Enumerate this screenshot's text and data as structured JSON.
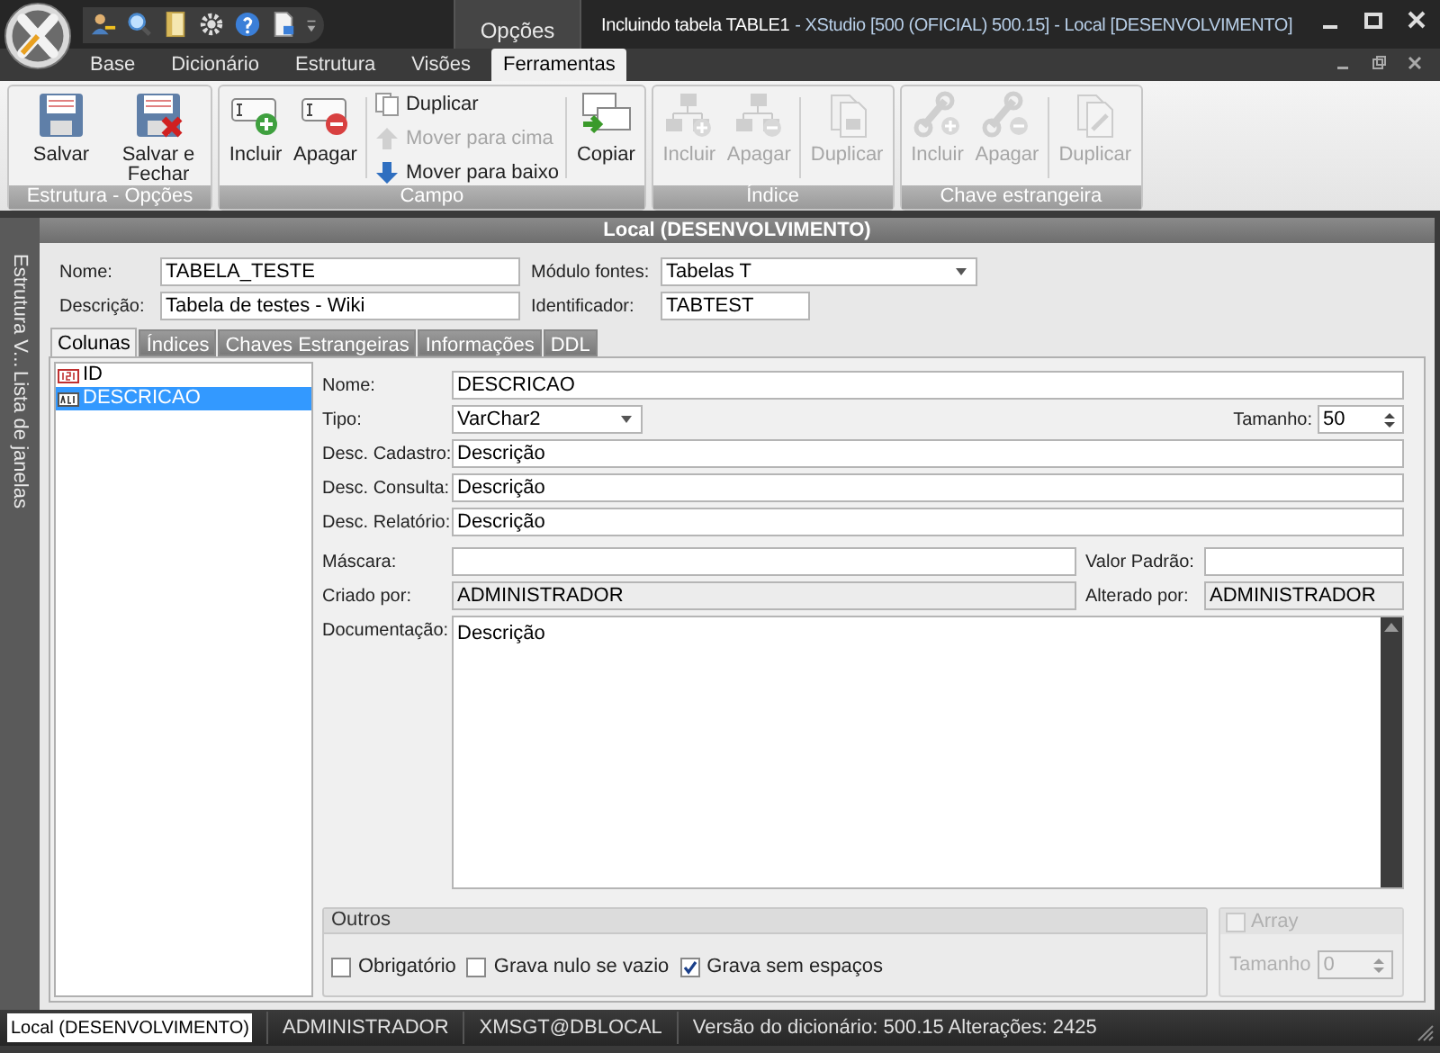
{
  "window": {
    "title": "Incluindo tabela TABLE1",
    "subtitle": "- XStudio [500 (OFICIAL) 500.15] - Local [DESENVOLVIMENTO]"
  },
  "contextual_tab_group": "Opções",
  "ribbon_tabs": [
    {
      "label": "Base",
      "selected": false
    },
    {
      "label": "Dicionário",
      "selected": false
    },
    {
      "label": "Estrutura",
      "selected": false
    },
    {
      "label": "Visões",
      "selected": false
    },
    {
      "label": "Ferramentas",
      "selected": true
    }
  ],
  "ribbon_groups": [
    {
      "label": "Estrutura - Opções",
      "buttons": [
        {
          "label": "Salvar",
          "kind": "large",
          "disabled": false
        },
        {
          "label": "Salvar e Fechar",
          "kind": "large",
          "disabled": false
        }
      ]
    },
    {
      "label": "Campo",
      "buttons": [
        {
          "label": "Incluir",
          "kind": "large",
          "disabled": false
        },
        {
          "label": "Apagar",
          "kind": "large",
          "disabled": false
        },
        {
          "label": "Duplicar",
          "kind": "small",
          "disabled": false
        },
        {
          "label": "Mover para cima",
          "kind": "small",
          "disabled": true
        },
        {
          "label": "Mover para baixo",
          "kind": "small",
          "disabled": false
        },
        {
          "label": "Copiar",
          "kind": "large",
          "disabled": false
        }
      ]
    },
    {
      "label": "Índice",
      "buttons": [
        {
          "label": "Incluir",
          "kind": "large",
          "disabled": true
        },
        {
          "label": "Apagar",
          "kind": "large",
          "disabled": true
        },
        {
          "label": "Duplicar",
          "kind": "large",
          "disabled": true
        }
      ]
    },
    {
      "label": "Chave estrangeira",
      "buttons": [
        {
          "label": "Incluir",
          "kind": "large",
          "disabled": true
        },
        {
          "label": "Apagar",
          "kind": "large",
          "disabled": true
        },
        {
          "label": "Duplicar",
          "kind": "large",
          "disabled": true
        }
      ]
    }
  ],
  "dock_tabs": [
    "Estrutura V...",
    "Lista de janelas"
  ],
  "panel_title": "Local (DESENVOLVIMENTO)",
  "table_fields": {
    "name": {
      "label": "Nome:",
      "value": "TABELA_TESTE"
    },
    "description": {
      "label": "Descrição:",
      "value": "Tabela de testes - Wiki"
    },
    "module": {
      "label": "Módulo fontes:",
      "value": "Tabelas T"
    },
    "identifier": {
      "label": "Identificador:",
      "value": "TABTEST"
    }
  },
  "tabs": [
    {
      "label": "Colunas",
      "selected": true
    },
    {
      "label": "Índices",
      "selected": false
    },
    {
      "label": "Chaves Estrangeiras",
      "selected": false
    },
    {
      "label": "Informações",
      "selected": false
    },
    {
      "label": "DDL",
      "selected": false
    }
  ],
  "columns": [
    {
      "name": "ID",
      "kind": "number",
      "selected": false
    },
    {
      "name": "DESCRICAO",
      "kind": "text",
      "selected": true
    }
  ],
  "column_detail": {
    "name": {
      "label": "Nome:",
      "value": "DESCRICAO",
      "readonly": false
    },
    "type": {
      "label": "Tipo:",
      "value": "VarChar2",
      "readonly": false
    },
    "size": {
      "label": "Tamanho:",
      "value": "50",
      "readonly": false
    },
    "desc_register": {
      "label": "Desc. Cadastro:",
      "value": "Descrição",
      "readonly": false
    },
    "desc_query": {
      "label": "Desc. Consulta:",
      "value": "Descrição",
      "readonly": false
    },
    "desc_report": {
      "label": "Desc. Relatório:",
      "value": "Descrição",
      "readonly": false
    },
    "mask": {
      "label": "Máscara:",
      "readonly": false
    },
    "default_value": {
      "label": "Valor Padrão:",
      "readonly": false
    },
    "created_by": {
      "label": "Criado por:",
      "value": "ADMINISTRADOR",
      "readonly": true
    },
    "changed_by": {
      "label": "Alterado por:",
      "value": "ADMINISTRADOR",
      "readonly": true
    },
    "documentation": {
      "label": "Documentação:",
      "value": "Descrição",
      "readonly": false
    }
  },
  "others": {
    "title": "Outros",
    "options": [
      {
        "label": "Obrigatório",
        "checked": false
      },
      {
        "label": "Grava nulo se vazio",
        "checked": false
      },
      {
        "label": "Grava sem espaços",
        "checked": true
      }
    ]
  },
  "array": {
    "label": "Array",
    "checked": false,
    "disabled": true,
    "size_label": "Tamanho",
    "size_value": "0"
  },
  "status_bar": {
    "connection": "Local (DESENVOLVIMENTO)",
    "user": "ADMINISTRADOR",
    "database": "XMSGT@DBLOCAL",
    "version": "Versão do dicionário: 500.15 Alterações: 2425"
  }
}
